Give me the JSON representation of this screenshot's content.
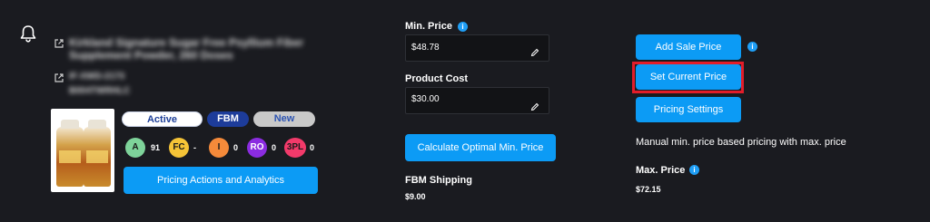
{
  "header": {
    "bell_icon": "bell-icon"
  },
  "product": {
    "title_line1": "Kirkland Signature Sugar Free Psyllium Fiber",
    "title_line2": "Supplement Powder, 260 Doses",
    "sku": "IF-XWD-2173",
    "asin": "B004TWRHLC",
    "image_alt": "Product bottles",
    "statuses": {
      "active": "Active",
      "fbm": "FBM",
      "new": "New"
    },
    "scores": [
      {
        "code": "A",
        "value": "91",
        "color": "#7ed39a"
      },
      {
        "code": "FC",
        "value": "-",
        "color": "#f5c437"
      },
      {
        "code": "I",
        "value": "0",
        "color": "#f58a3a"
      },
      {
        "code": "RO",
        "value": "0",
        "color": "#8b2ce0"
      },
      {
        "code": "3PL",
        "value": "0",
        "color": "#f23a6a"
      }
    ],
    "actions_button": "Pricing Actions and Analytics"
  },
  "pricing": {
    "min_price_label": "Min. Price",
    "min_price_value": "$48.78",
    "product_cost_label": "Product Cost",
    "product_cost_value": "$30.00",
    "calc_button": "Calculate Optimal Min. Price",
    "fbm_shipping_label": "FBM Shipping",
    "fbm_shipping_value": "$9.00"
  },
  "right": {
    "add_sale_price": "Add Sale Price",
    "set_current_price": "Set Current Price",
    "pricing_settings": "Pricing Settings",
    "strategy_text": "Manual min. price based pricing with max. price",
    "max_price_label": "Max. Price",
    "max_price_value": "$72.15"
  },
  "colors": {
    "background": "#1a1b20",
    "accent": "#0c9bf5",
    "highlight": "#e21d2a"
  }
}
